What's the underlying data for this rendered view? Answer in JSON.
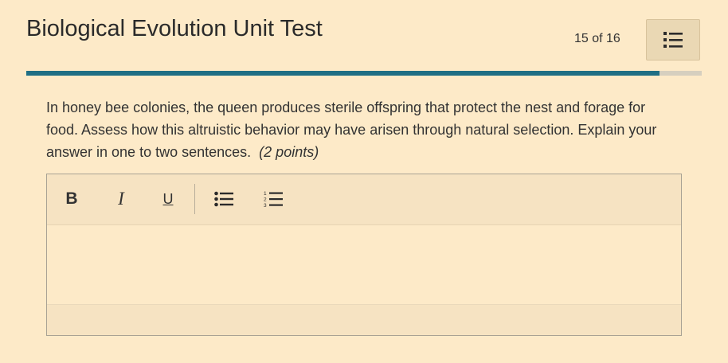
{
  "header": {
    "title": "Biological Evolution Unit Test",
    "counter": "15 of 16",
    "menu_icon": "list-icon"
  },
  "progress": {
    "fraction": 0.9375,
    "color": "#1f6f85"
  },
  "question": {
    "text": "In honey bee colonies, the queen produces sterile offspring that protect the nest and forage for food. Assess how this altruistic behavior may have arisen through natural selection. Explain your answer in one to two sentences.",
    "points": "(2 points)"
  },
  "editor": {
    "toolbar": {
      "bold": "B",
      "italic": "I",
      "underline": "U",
      "bulleted_list_icon": "bulleted-list-icon",
      "numbered_list_icon": "numbered-list-icon"
    },
    "answer": ""
  }
}
